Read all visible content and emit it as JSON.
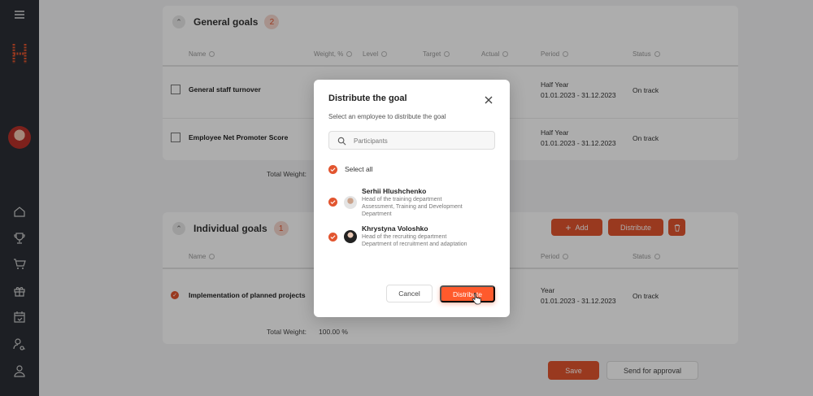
{
  "sidebar": {
    "menu_icon": "hamburger-icon",
    "logo": "H",
    "nav_icons": [
      "home-icon",
      "trophy-icon",
      "cart-icon",
      "gift-icon",
      "calendar-icon",
      "people-search-icon",
      "user-icon"
    ]
  },
  "general": {
    "title": "General goals",
    "count": "2",
    "columns": {
      "name": "Name",
      "weight": "Weight, %",
      "level": "Level",
      "target": "Target",
      "actual": "Actual",
      "period": "Period",
      "status": "Status"
    },
    "rows": [
      {
        "name": "General staff turnover",
        "period_type": "Half Year",
        "period_range": "01.01.2023 - 31.12.2023",
        "status": "On track"
      },
      {
        "name": "Employee Net Promoter Score",
        "period_type": "Half Year",
        "period_range": "01.01.2023 - 31.12.2023",
        "status": "On track"
      }
    ],
    "total_label": "Total Weight:"
  },
  "individual": {
    "title": "Individual goals",
    "count": "1",
    "add_label": "Add",
    "distribute_label": "Distribute",
    "columns": {
      "name": "Name",
      "period": "Period",
      "status": "Status"
    },
    "rows": [
      {
        "name": "Implementation of planned projects",
        "period_type": "Year",
        "period_range": "01.01.2023 - 31.12.2023",
        "status": "On track"
      }
    ],
    "total_label": "Total Weight:",
    "total_value": "100.00 %"
  },
  "footer": {
    "save_label": "Save",
    "approval_label": "Send for approval"
  },
  "modal": {
    "title": "Distribute the goal",
    "subtitle": "Select an employee to distribute the goal",
    "search_placeholder": "Participants",
    "select_all": "Select all",
    "people": [
      {
        "name": "Serhii Hlushchenko",
        "line1": "Head of the training department",
        "line2": "Assessment, Training and Development Department"
      },
      {
        "name": "Khrystyna Voloshko",
        "line1": "Head of the recruiting department",
        "line2": "Department of recruitment and adaptation"
      }
    ],
    "cancel_label": "Cancel",
    "distribute_label": "Distribute"
  },
  "colors": {
    "accent": "#e2552f",
    "sidebar": "#2b2f36"
  }
}
